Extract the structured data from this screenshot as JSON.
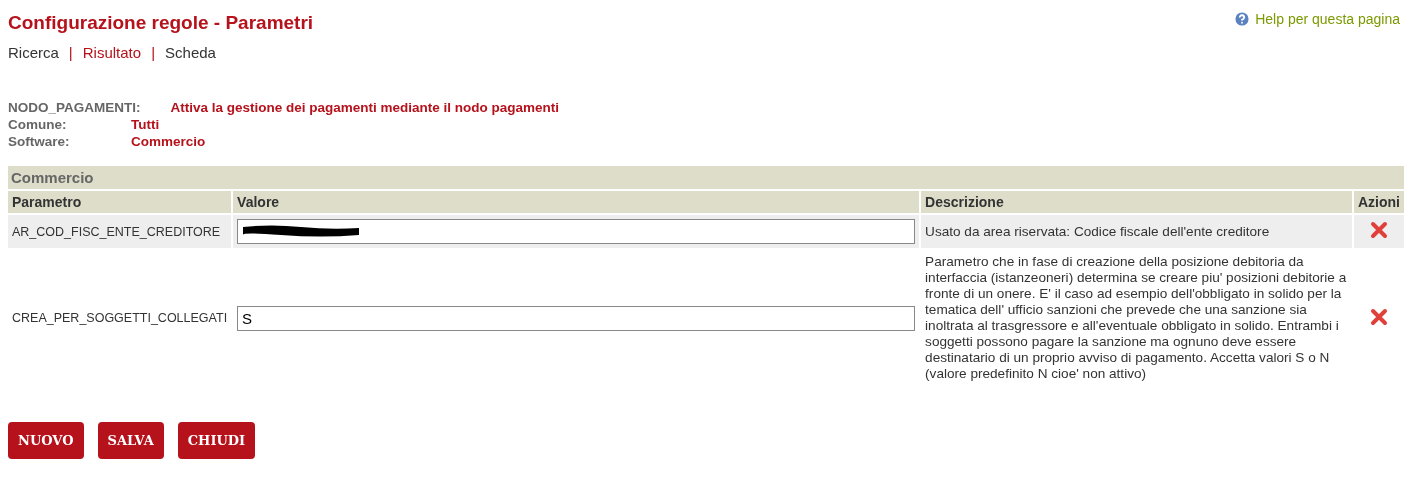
{
  "title": "Configurazione regole - Parametri",
  "help_link": "Help per questa pagina",
  "nav": [
    {
      "kind": "link",
      "label": "Ricerca",
      "selected": false
    },
    {
      "kind": "separator",
      "label": "|"
    },
    {
      "kind": "link",
      "label": "Risultato",
      "selected": true
    },
    {
      "kind": "separator",
      "label": "|"
    },
    {
      "kind": "link",
      "label": "Scheda",
      "selected": false
    }
  ],
  "info": [
    {
      "label": "NODO_PAGAMENTI:",
      "value": "Attiva la gestione dei pagamenti mediante il nodo pagamenti"
    },
    {
      "label": "Comune:",
      "value": "Tutti"
    },
    {
      "label": "Software:",
      "value": "Commercio"
    }
  ],
  "table": {
    "group": "Commercio",
    "columns": [
      "Parametro",
      "Valore",
      "Descrizione",
      "Azioni"
    ],
    "rows": [
      {
        "parameter": "AR_COD_FISC_ENTE_CREDITORE",
        "value": "",
        "redacted": true,
        "description": "Usato da area riservata: Codice fiscale dell'ente creditore"
      },
      {
        "parameter": "CREA_PER_SOGGETTI_COLLEGATI",
        "value": "S",
        "redacted": false,
        "description": "Parametro che in fase di creazione della posizione debitoria da interfaccia (istanzeoneri) determina se creare piu' posizioni debitorie a fronte di un onere. E' il caso ad esempio dell'obbligato in solido per la tematica dell' ufficio sanzioni che prevede che una sanzione sia inoltrata al trasgressore e all'eventuale obbligato in solido. Entrambi i soggetti possono pagare la sanzione ma ognuno deve essere destinatario di un proprio avviso di pagamento. Accetta valori S o N (valore predefinito N cioe' non attivo)"
      }
    ]
  },
  "buttons": [
    "NUOVO",
    "SALVA",
    "CHIUDI"
  ]
}
